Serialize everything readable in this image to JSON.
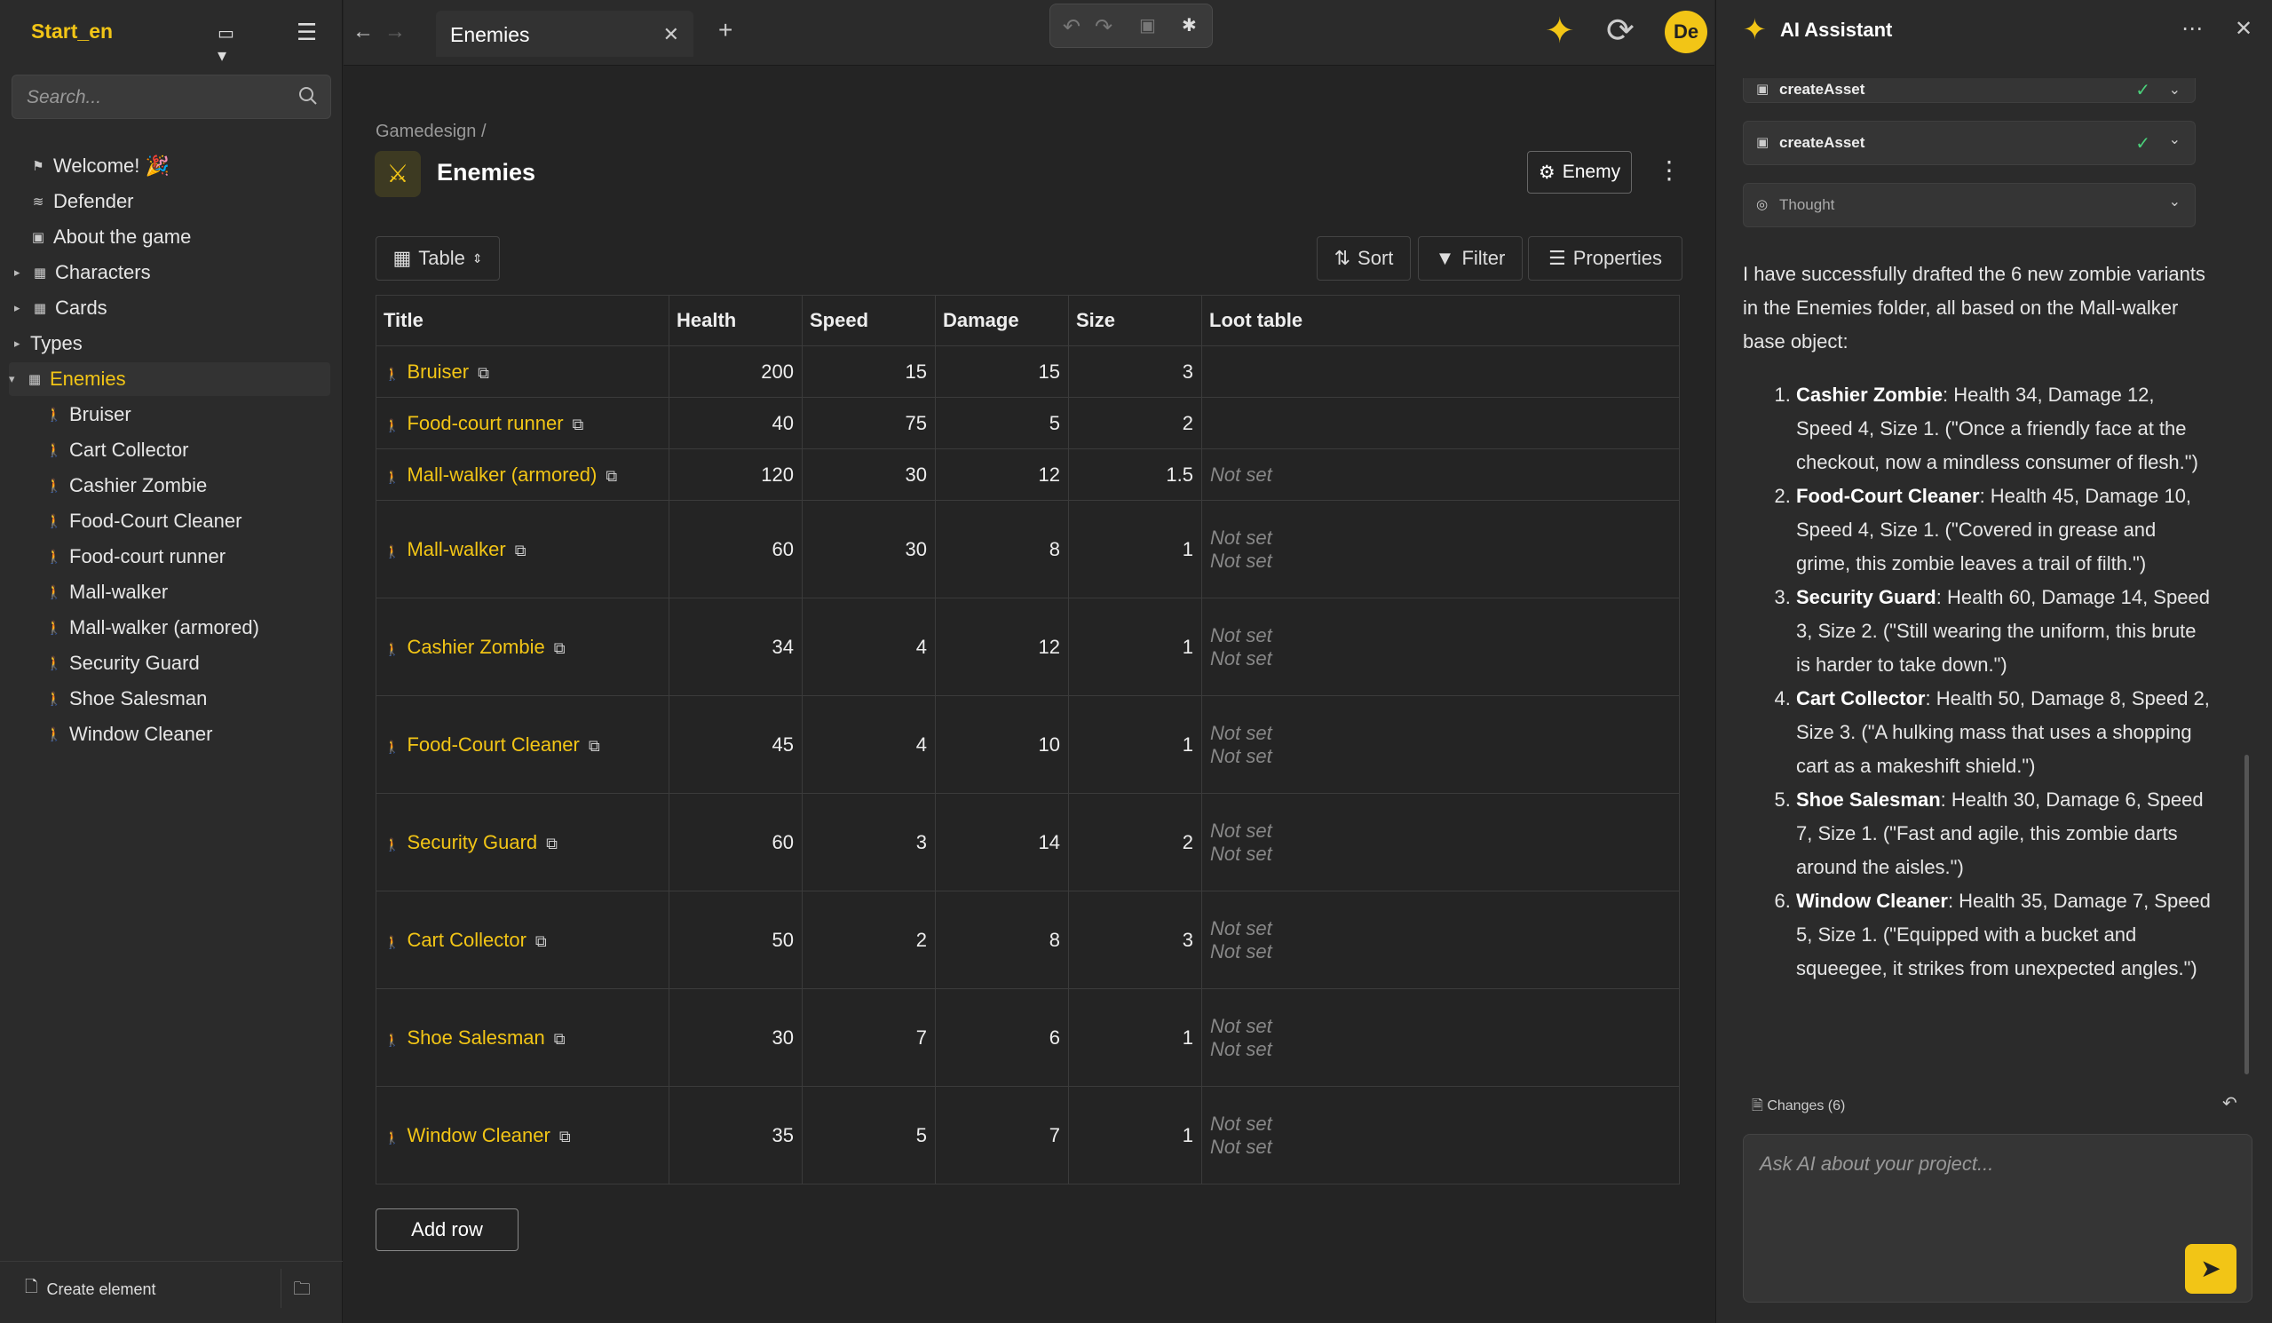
{
  "sidebar": {
    "project_name": "Start_en",
    "search_placeholder": "Search...",
    "items": [
      {
        "label": "Welcome! 🎉",
        "icon": "flag-icon"
      },
      {
        "label": "Defender",
        "icon": "layers-icon"
      },
      {
        "label": "About the game",
        "icon": "image-icon"
      },
      {
        "label": "Characters",
        "icon": "table-icon"
      },
      {
        "label": "Cards",
        "icon": "table-icon"
      },
      {
        "label": "Types",
        "icon": ""
      },
      {
        "label": "Enemies",
        "icon": "table-icon"
      },
      {
        "label": "Bruiser"
      },
      {
        "label": "Cart Collector"
      },
      {
        "label": "Cashier Zombie"
      },
      {
        "label": "Food-Court Cleaner"
      },
      {
        "label": "Food-court runner"
      },
      {
        "label": "Mall-walker"
      },
      {
        "label": "Mall-walker (armored)"
      },
      {
        "label": "Security Guard"
      },
      {
        "label": "Shoe Salesman"
      },
      {
        "label": "Window Cleaner"
      }
    ],
    "create_label": "Create element"
  },
  "topbar": {
    "tab_label": "Enemies",
    "avatar_initials": "De"
  },
  "page": {
    "breadcrumb": "Gamedesign /",
    "title": "Enemies",
    "template_label": "Enemy",
    "view_label": "Table",
    "sort_label": "Sort",
    "filter_label": "Filter",
    "properties_label": "Properties",
    "add_row_label": "Add row",
    "not_set": "Not set"
  },
  "table": {
    "headers": [
      "Title",
      "Health",
      "Speed",
      "Damage",
      "Size",
      "Loot table"
    ],
    "rows": [
      {
        "title": "Bruiser",
        "health": "200",
        "speed": "15",
        "damage": "15",
        "size": "3",
        "loot": 0
      },
      {
        "title": "Food-court runner",
        "health": "40",
        "speed": "75",
        "damage": "5",
        "size": "2",
        "loot": 0
      },
      {
        "title": "Mall-walker (armored)",
        "health": "120",
        "speed": "30",
        "damage": "12",
        "size": "1.5",
        "loot": 1
      },
      {
        "title": "Mall-walker",
        "health": "60",
        "speed": "30",
        "damage": "8",
        "size": "1",
        "loot": 2
      },
      {
        "title": "Cashier Zombie",
        "health": "34",
        "speed": "4",
        "damage": "12",
        "size": "1",
        "loot": 2
      },
      {
        "title": "Food-Court Cleaner",
        "health": "45",
        "speed": "4",
        "damage": "10",
        "size": "1",
        "loot": 2
      },
      {
        "title": "Security Guard",
        "health": "60",
        "speed": "3",
        "damage": "14",
        "size": "2",
        "loot": 2
      },
      {
        "title": "Cart Collector",
        "health": "50",
        "speed": "2",
        "damage": "8",
        "size": "3",
        "loot": 2
      },
      {
        "title": "Shoe Salesman",
        "health": "30",
        "speed": "7",
        "damage": "6",
        "size": "1",
        "loot": 2
      },
      {
        "title": "Window Cleaner",
        "health": "35",
        "speed": "5",
        "damage": "7",
        "size": "1",
        "loot": 2
      }
    ]
  },
  "ai": {
    "title": "AI Assistant",
    "tool_calls": [
      "createAsset",
      "createAsset"
    ],
    "thought_label": "Thought",
    "intro": "I have successfully drafted the 6 new zombie variants in the Enemies folder, all based on the Mall-walker base object:",
    "list": [
      {
        "name": "Cashier Zombie",
        "text": ": Health 34, Damage 12, Speed 4, Size 1. (\"Once a friendly face at the checkout, now a mindless consumer of flesh.\")"
      },
      {
        "name": "Food-Court Cleaner",
        "text": ": Health 45, Damage 10, Speed 4, Size 1. (\"Covered in grease and grime, this zombie leaves a trail of filth.\")"
      },
      {
        "name": "Security Guard",
        "text": ": Health 60, Damage 14, Speed 3, Size 2. (\"Still wearing the uniform, this brute is harder to take down.\")"
      },
      {
        "name": "Cart Collector",
        "text": ": Health 50, Damage 8, Speed 2, Size 3. (\"A hulking mass that uses a shopping cart as a makeshift shield.\")"
      },
      {
        "name": "Shoe Salesman",
        "text": ": Health 30, Damage 6, Speed 7, Size 1. (\"Fast and agile, this zombie darts around the aisles.\")"
      },
      {
        "name": "Window Cleaner",
        "text": ": Health 35, Damage 7, Speed 5, Size 1. (\"Equipped with a bucket and squeegee, it strikes from unexpected angles.\")"
      }
    ],
    "changes_label": "Changes (6)",
    "input_placeholder": "Ask AI about your project..."
  },
  "colors": {
    "accent": "#f2c516",
    "background": "#242424",
    "panel": "#2b2b2b",
    "success": "#4ad07a"
  }
}
